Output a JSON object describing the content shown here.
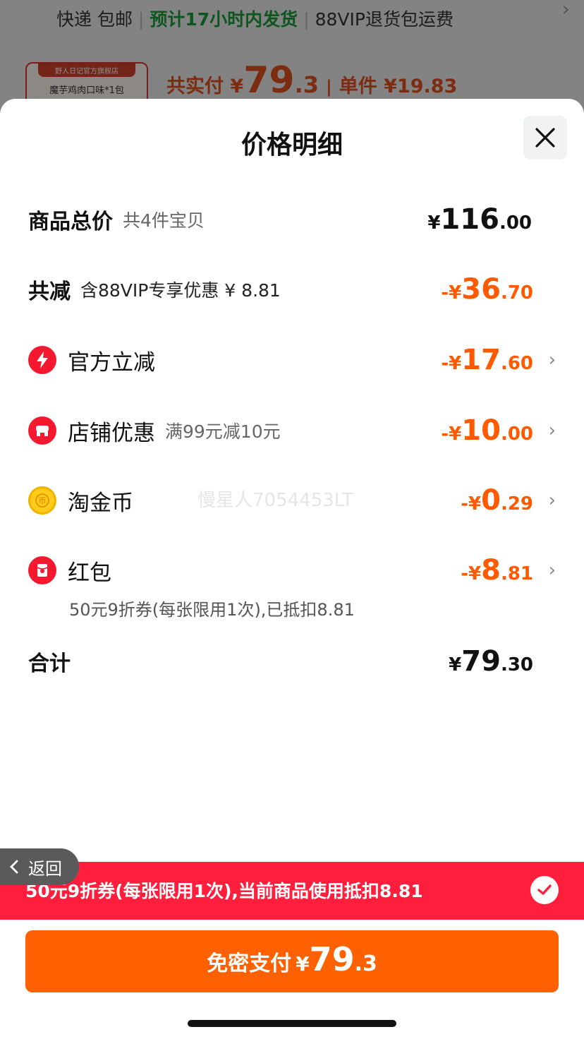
{
  "background": {
    "shipping": "快递 包邮",
    "dispatch": "预计17小时内发货",
    "return_fee": "88VIP退货包运费",
    "shop_label": "野人日记官方旗舰店",
    "product": "魔芋鸡肉口味*1包",
    "paid_label": "共实付 ¥",
    "paid_int": "79",
    "paid_dec": ".3",
    "unit_price": "单件 ¥19.83"
  },
  "sheet": {
    "title": "价格明细",
    "rows": {
      "total": {
        "label": "商品总价",
        "sub": "共4件宝贝",
        "yen": "¥",
        "int": "116",
        "dec": ".00"
      },
      "reduce": {
        "label": "共减",
        "sub": "含88VIP专享优惠 ¥ 8.81",
        "yen": "-¥",
        "int": "36",
        "dec": ".70"
      },
      "official": {
        "label": "官方立减",
        "yen": "-¥",
        "int": "17",
        "dec": ".60"
      },
      "store": {
        "label": "店铺优惠",
        "sub": "满99元减10元",
        "yen": "-¥",
        "int": "10",
        "dec": ".00"
      },
      "coins": {
        "label": "淘金币",
        "yen": "-¥",
        "int": "0",
        "dec": ".29"
      },
      "redpacket": {
        "label": "红包",
        "yen": "-¥",
        "int": "8",
        "dec": ".81",
        "note": "50元9折券(每张限用1次),已抵扣8.81"
      },
      "sum": {
        "label": "合计",
        "yen": "¥",
        "int": "79",
        "dec": ".30"
      }
    },
    "watermark": "慢星人7054453LT"
  },
  "footer": {
    "back_label": "返回",
    "coupon_text": "50元9折券(每张限用1次),当前商品使用抵扣8.81",
    "pay_label": "免密支付",
    "pay_yen": "¥",
    "pay_int": "79",
    "pay_dec": ".3"
  },
  "colors": {
    "accent_orange": "#ff6000",
    "discount_orange": "#ff5a00",
    "alert_red": "#ff1f3d"
  },
  "icons": [
    "bolt-icon",
    "store-icon",
    "coin-icon",
    "red-packet-icon",
    "close-icon",
    "chevron-right-icon",
    "check-icon",
    "back-arrow-icon"
  ]
}
